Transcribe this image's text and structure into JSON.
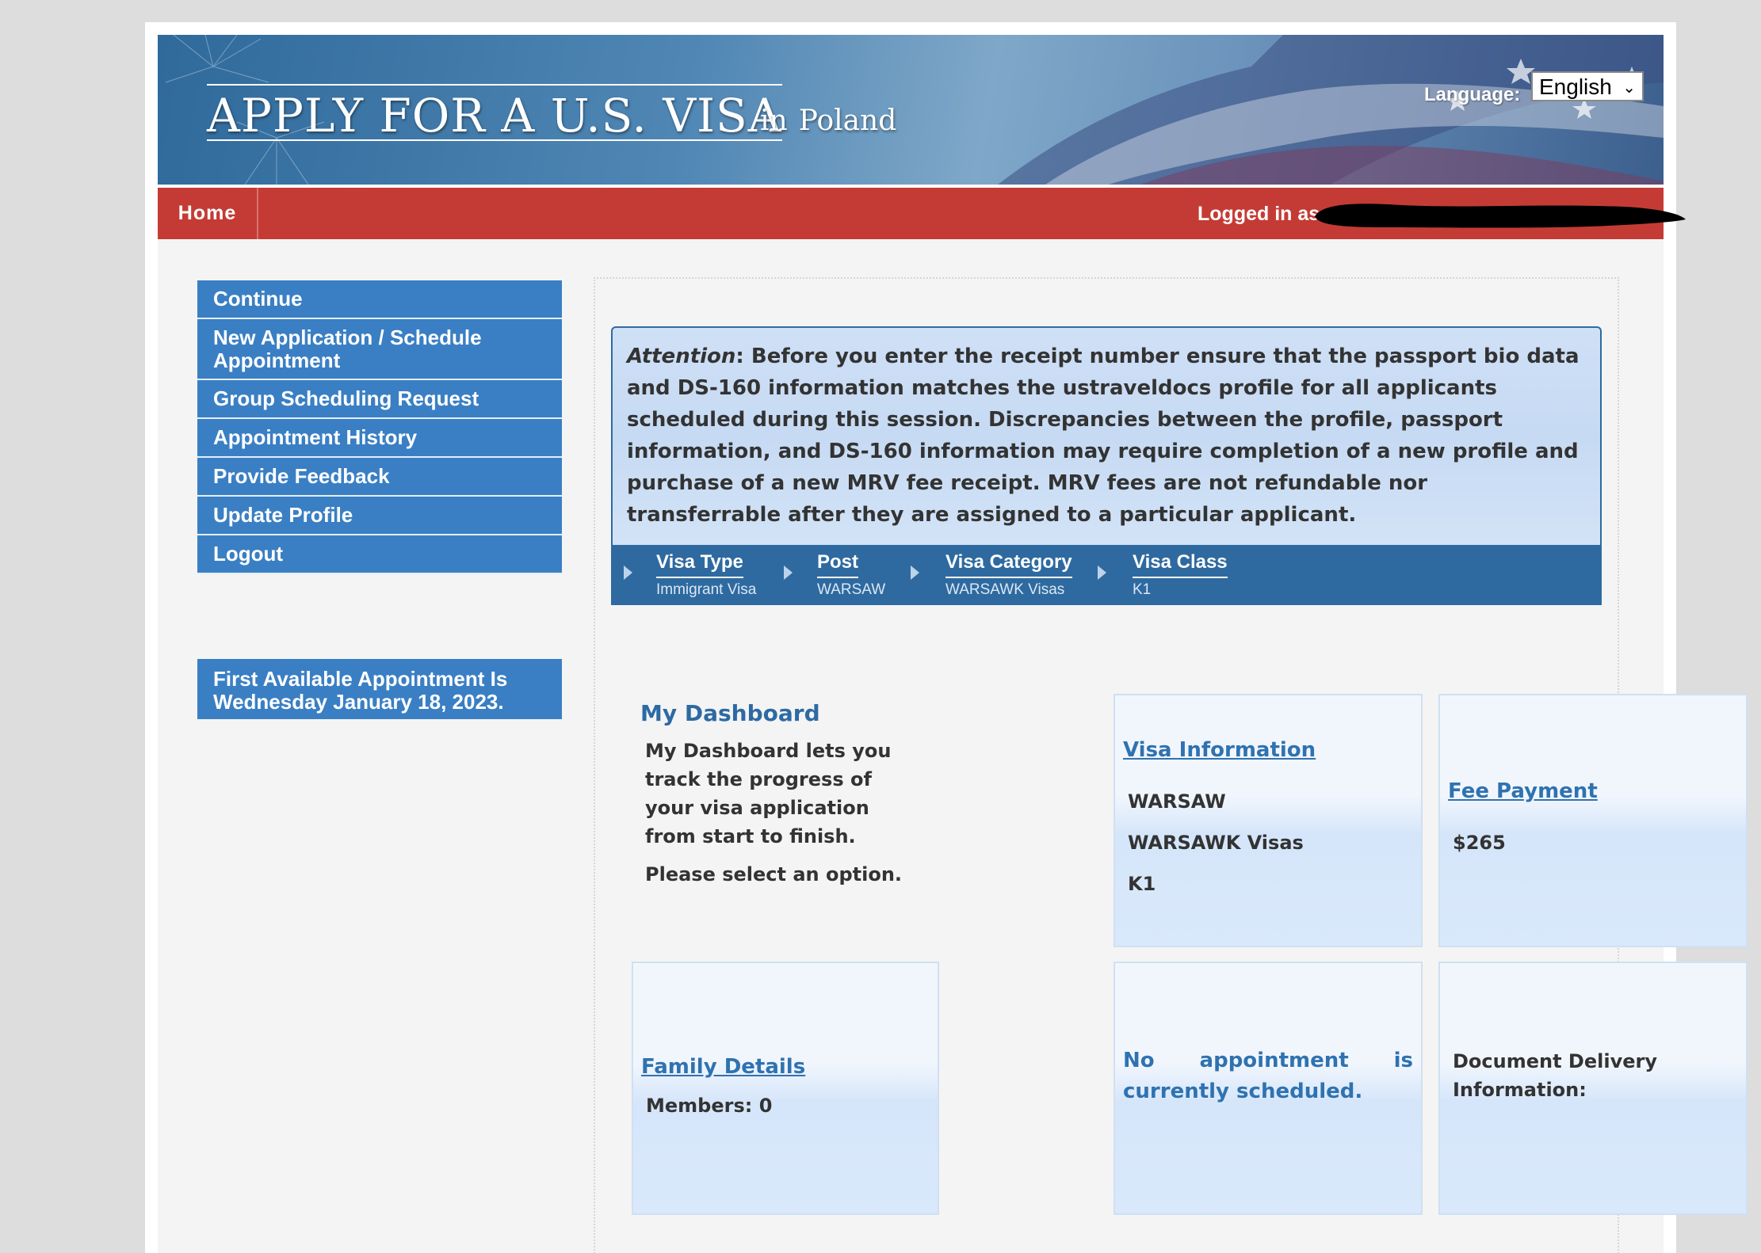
{
  "header": {
    "title": "APPLY FOR A U.S. VISA",
    "in_word": "in",
    "country": "Poland",
    "language_label": "Language:",
    "language_value": "English"
  },
  "nav": {
    "home": "Home",
    "logged_in_as": "Logged in as"
  },
  "sidebar": {
    "items": [
      {
        "label": "Continue"
      },
      {
        "label": "New Application / Schedule Appointment"
      },
      {
        "label": "Group Scheduling Request"
      },
      {
        "label": "Appointment History"
      },
      {
        "label": "Provide Feedback"
      },
      {
        "label": "Update Profile"
      },
      {
        "label": "Logout"
      }
    ],
    "first_available": "First Available Appointment Is Wednesday January 18, 2023."
  },
  "attention": {
    "label": "Attention",
    "text": ": Before you enter the receipt number ensure that the passport bio data and DS-160 information matches the ustraveldocs profile for all applicants scheduled during this session. Discrepancies between the profile, passport information, and DS-160 information may require completion of a new profile and purchase of a new MRV fee receipt. MRV fees are not refundable nor transferrable after they are assigned to a particular applicant."
  },
  "breadcrumb": [
    {
      "title": "Visa Type",
      "value": "Immigrant Visa"
    },
    {
      "title": "Post",
      "value": "WARSAW"
    },
    {
      "title": "Visa Category",
      "value": "WARSAWK Visas"
    },
    {
      "title": "Visa Class",
      "value": "K1"
    }
  ],
  "dashboard": {
    "title": "My Dashboard",
    "description": "My Dashboard lets you track the progress of your visa application from start to finish.",
    "prompt": "Please select an option."
  },
  "cards": {
    "visa_info": {
      "link": "Visa Information",
      "post": "WARSAW",
      "category": "WARSAWK Visas",
      "class": "K1"
    },
    "fee_payment": {
      "link": "Fee Payment",
      "amount": "$265"
    },
    "family": {
      "link": "Family Details",
      "members": "Members: 0"
    },
    "appointment": {
      "text": "No appointment is currently scheduled."
    },
    "document_delivery": {
      "text": "Document Delivery Information:"
    }
  },
  "colors": {
    "nav_red": "#c43b35",
    "sidebar_blue": "#3a7fc4",
    "breadcrumb_blue": "#2e6aa0",
    "link_blue": "#2f72b0"
  }
}
